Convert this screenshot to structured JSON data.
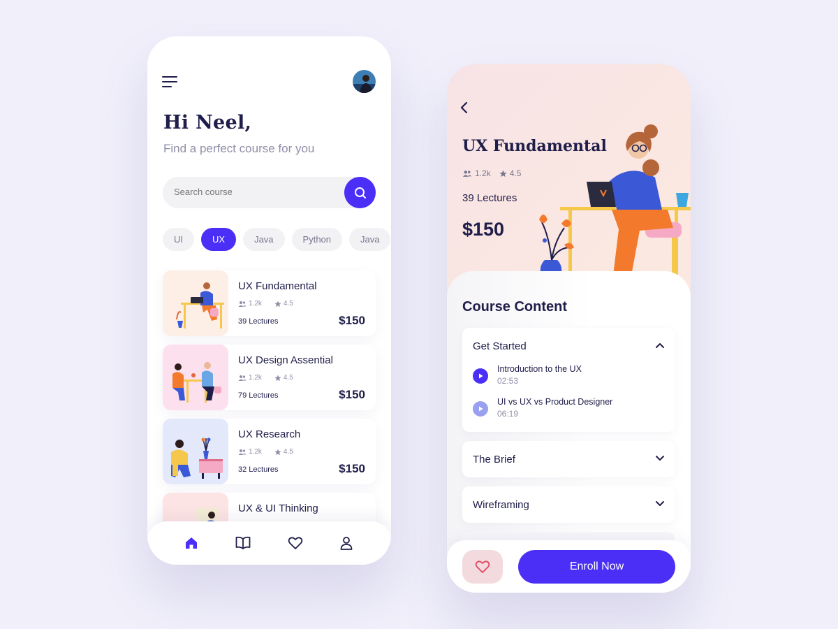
{
  "colors": {
    "accent": "#4c2ff7",
    "text": "#1f1d4a",
    "muted": "#8f8ea8",
    "favorite_bg": "#f3dadf"
  },
  "home": {
    "greeting": "Hi Neel,",
    "subtitle": "Find a perfect course for you",
    "search": {
      "placeholder": "Search course"
    },
    "chips": [
      {
        "label": "UI",
        "active": false
      },
      {
        "label": "UX",
        "active": true
      },
      {
        "label": "Java",
        "active": false
      },
      {
        "label": "Python",
        "active": false
      },
      {
        "label": "Java",
        "active": false
      }
    ],
    "courses": [
      {
        "title": "UX Fundamental",
        "students": "1.2k",
        "rating": "4.5",
        "lectures": "39 Lectures",
        "price": "$150"
      },
      {
        "title": "UX Design Assential",
        "students": "1.2k",
        "rating": "4.5",
        "lectures": "79 Lectures",
        "price": "$150"
      },
      {
        "title": "UX Research",
        "students": "1.2k",
        "rating": "4.5",
        "lectures": "32 Lectures",
        "price": "$150"
      },
      {
        "title": "UX & UI Thinking"
      }
    ],
    "nav": [
      "home-icon",
      "book-icon",
      "heart-icon",
      "user-icon"
    ]
  },
  "detail": {
    "title": "UX Fundamental",
    "students": "1.2k",
    "rating": "4.5",
    "lectures": "39 Lectures",
    "price": "$150",
    "content_heading": "Course Content",
    "sections": [
      {
        "title": "Get Started",
        "expanded": true,
        "lessons": [
          {
            "title": "Introduction to the UX",
            "time": "02:53"
          },
          {
            "title": "UI vs UX vs Product Designer",
            "time": "06:19"
          }
        ]
      },
      {
        "title": "The Brief",
        "expanded": false
      },
      {
        "title": "Wireframing",
        "expanded": false
      }
    ],
    "enroll_label": "Enroll Now"
  }
}
